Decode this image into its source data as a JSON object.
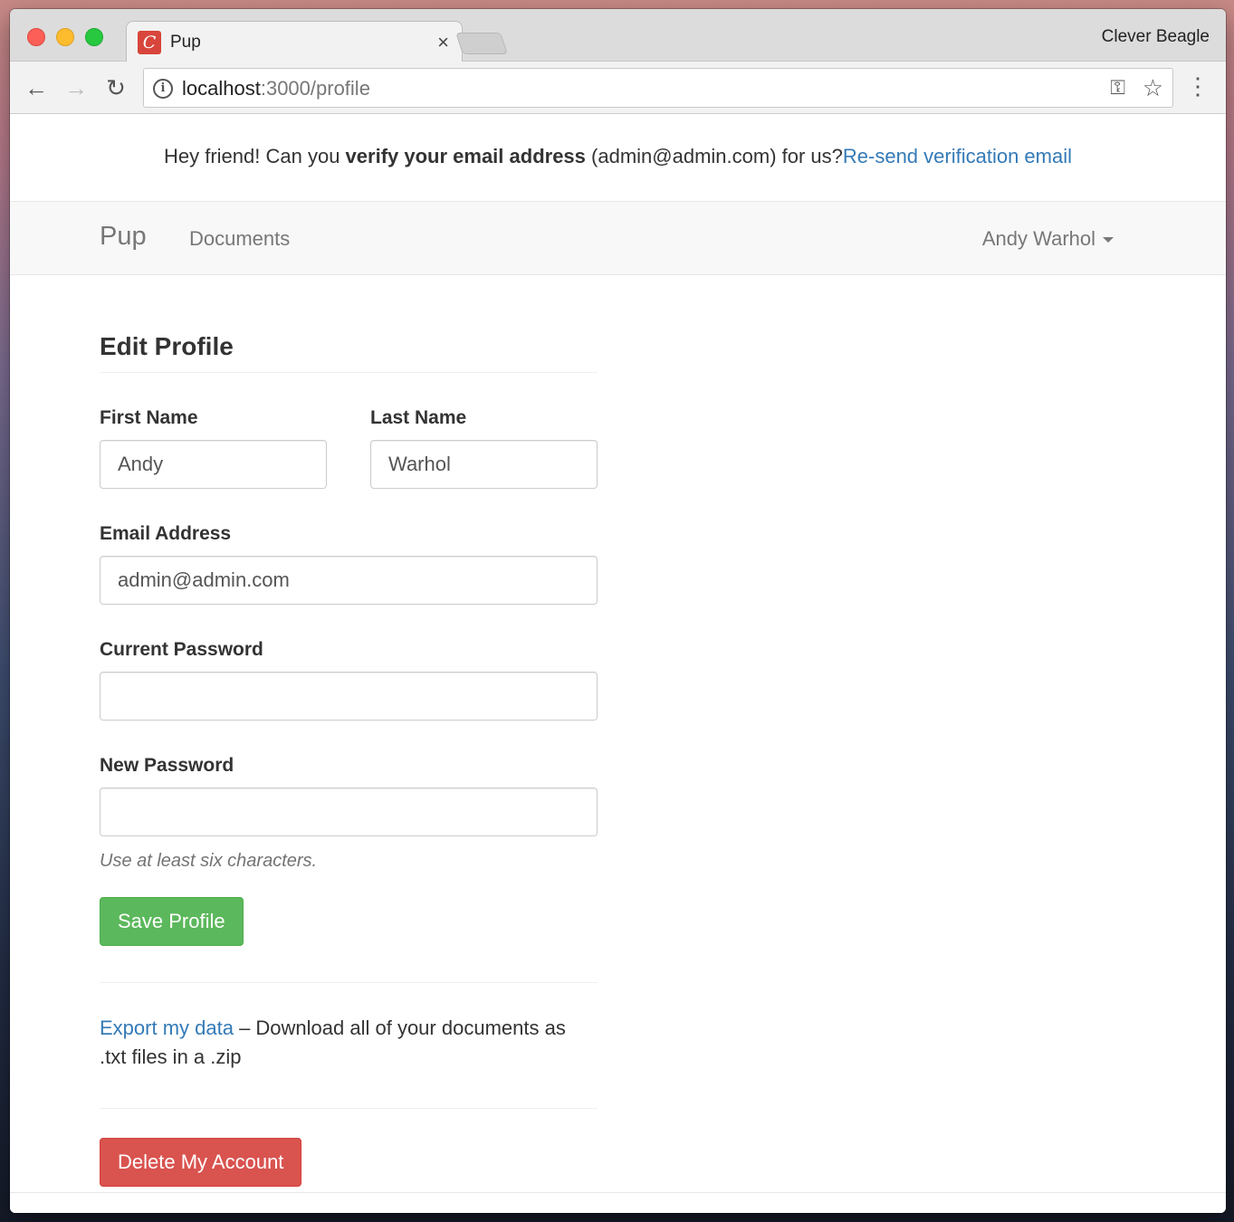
{
  "browser": {
    "tab_title": "Pup",
    "tab_favicon_letter": "C",
    "tab_close": "×",
    "profile_name": "Clever Beagle",
    "url_host": "localhost",
    "url_path": ":3000/profile",
    "icons": {
      "back": "arrow-left",
      "forward": "arrow-right",
      "reload": "reload",
      "info": "info-circle",
      "key": "key",
      "star": "star",
      "menu": "kebab-menu"
    }
  },
  "banner": {
    "prefix": "Hey friend! Can you ",
    "bold": "verify your email address",
    "suffix": " (admin@admin.com) for us?",
    "link": "Re-send verification email"
  },
  "navbar": {
    "brand": "Pup",
    "documents": "Documents",
    "user": "Andy Warhol"
  },
  "form": {
    "title": "Edit Profile",
    "first_name_label": "First Name",
    "first_name_value": "Andy",
    "last_name_label": "Last Name",
    "last_name_value": "Warhol",
    "email_label": "Email Address",
    "email_value": "admin@admin.com",
    "current_password_label": "Current Password",
    "current_password_value": "",
    "new_password_label": "New Password",
    "new_password_value": "",
    "help_text": "Use at least six characters.",
    "save_button": "Save Profile"
  },
  "export": {
    "link": "Export my data",
    "text": " – Download all of your documents as .txt files in a .zip"
  },
  "delete_button": "Delete My Account",
  "colors": {
    "link": "#337ab7",
    "success": "#5cb85c",
    "danger": "#d9534f"
  }
}
